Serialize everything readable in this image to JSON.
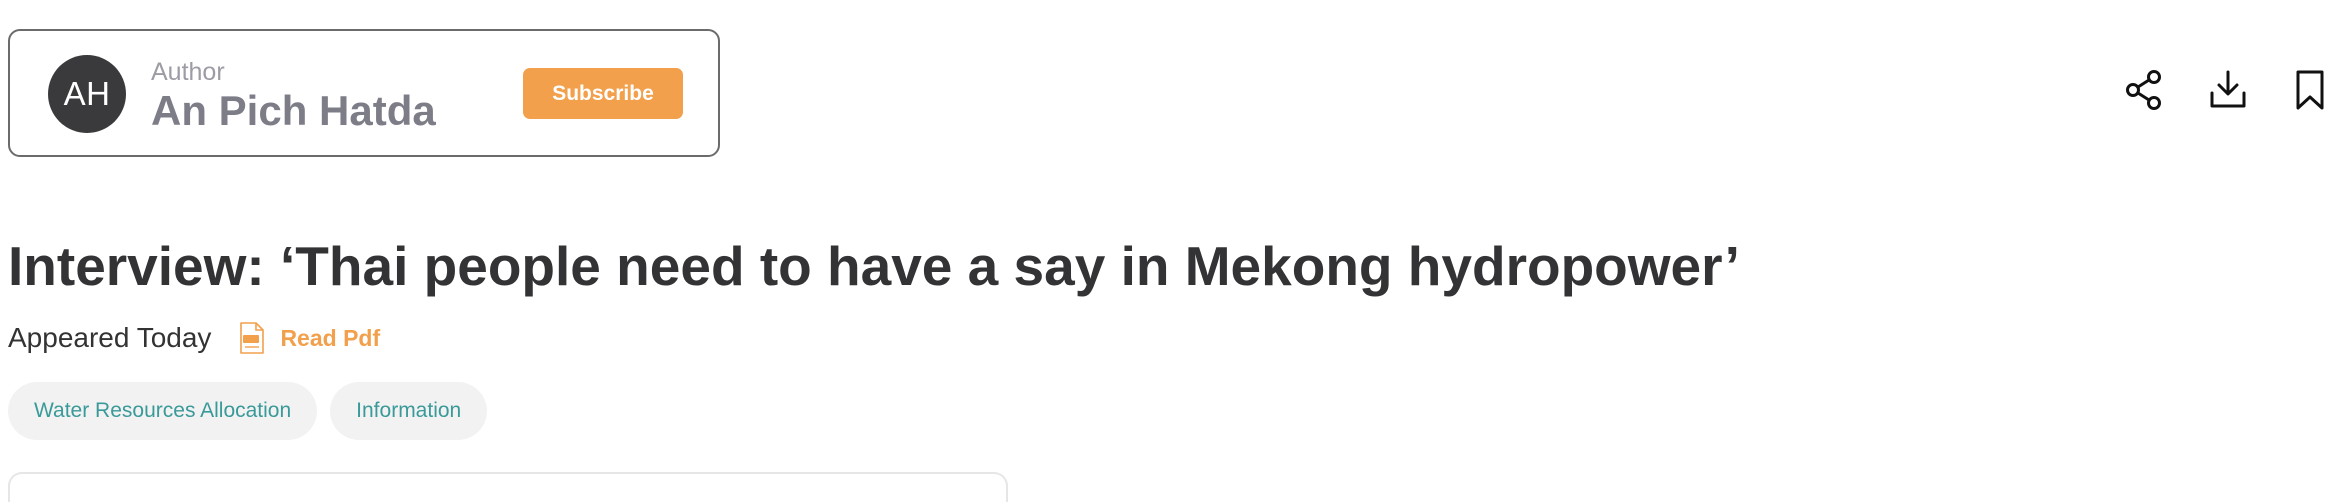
{
  "author": {
    "label": "Author",
    "name": "An Pich Hatda",
    "initials": "AH",
    "subscribe_label": "Subscribe"
  },
  "toolbar": {
    "icons": [
      "share-icon",
      "download-icon",
      "bookmark-icon"
    ]
  },
  "article": {
    "title": "Interview: ‘Thai people need to have a say in Mekong hydropower’",
    "appeared": "Appeared Today",
    "read_pdf_label": "Read Pdf",
    "tags": [
      "Water Resources Allocation",
      "Information"
    ]
  },
  "colors": {
    "accent": "#f2a04c",
    "tag_text": "#3a9a99",
    "tag_bg": "#f2f2f2",
    "avatar_bg": "#3a3a3c",
    "title": "#333336"
  }
}
